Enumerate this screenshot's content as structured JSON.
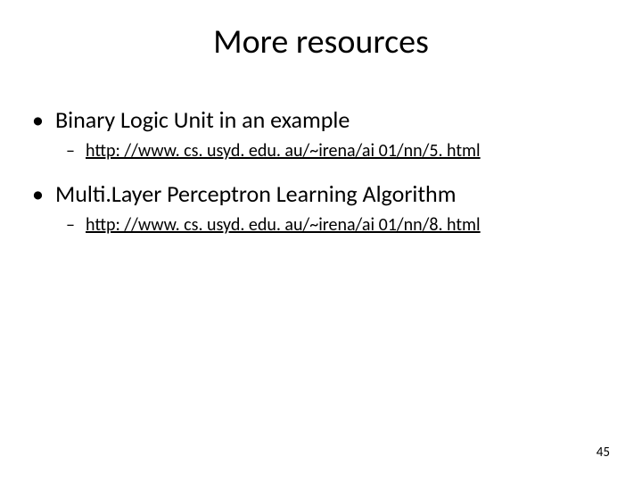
{
  "title": "More resources",
  "items": [
    {
      "text": "Binary Logic Unit in an example",
      "link": "http: //www. cs. usyd. edu. au/~irena/ai 01/nn/5. html"
    },
    {
      "text": "Multi.Layer Perceptron Learning Algorithm",
      "link": "http: //www. cs. usyd. edu. au/~irena/ai 01/nn/8. html"
    }
  ],
  "page_number": "45"
}
